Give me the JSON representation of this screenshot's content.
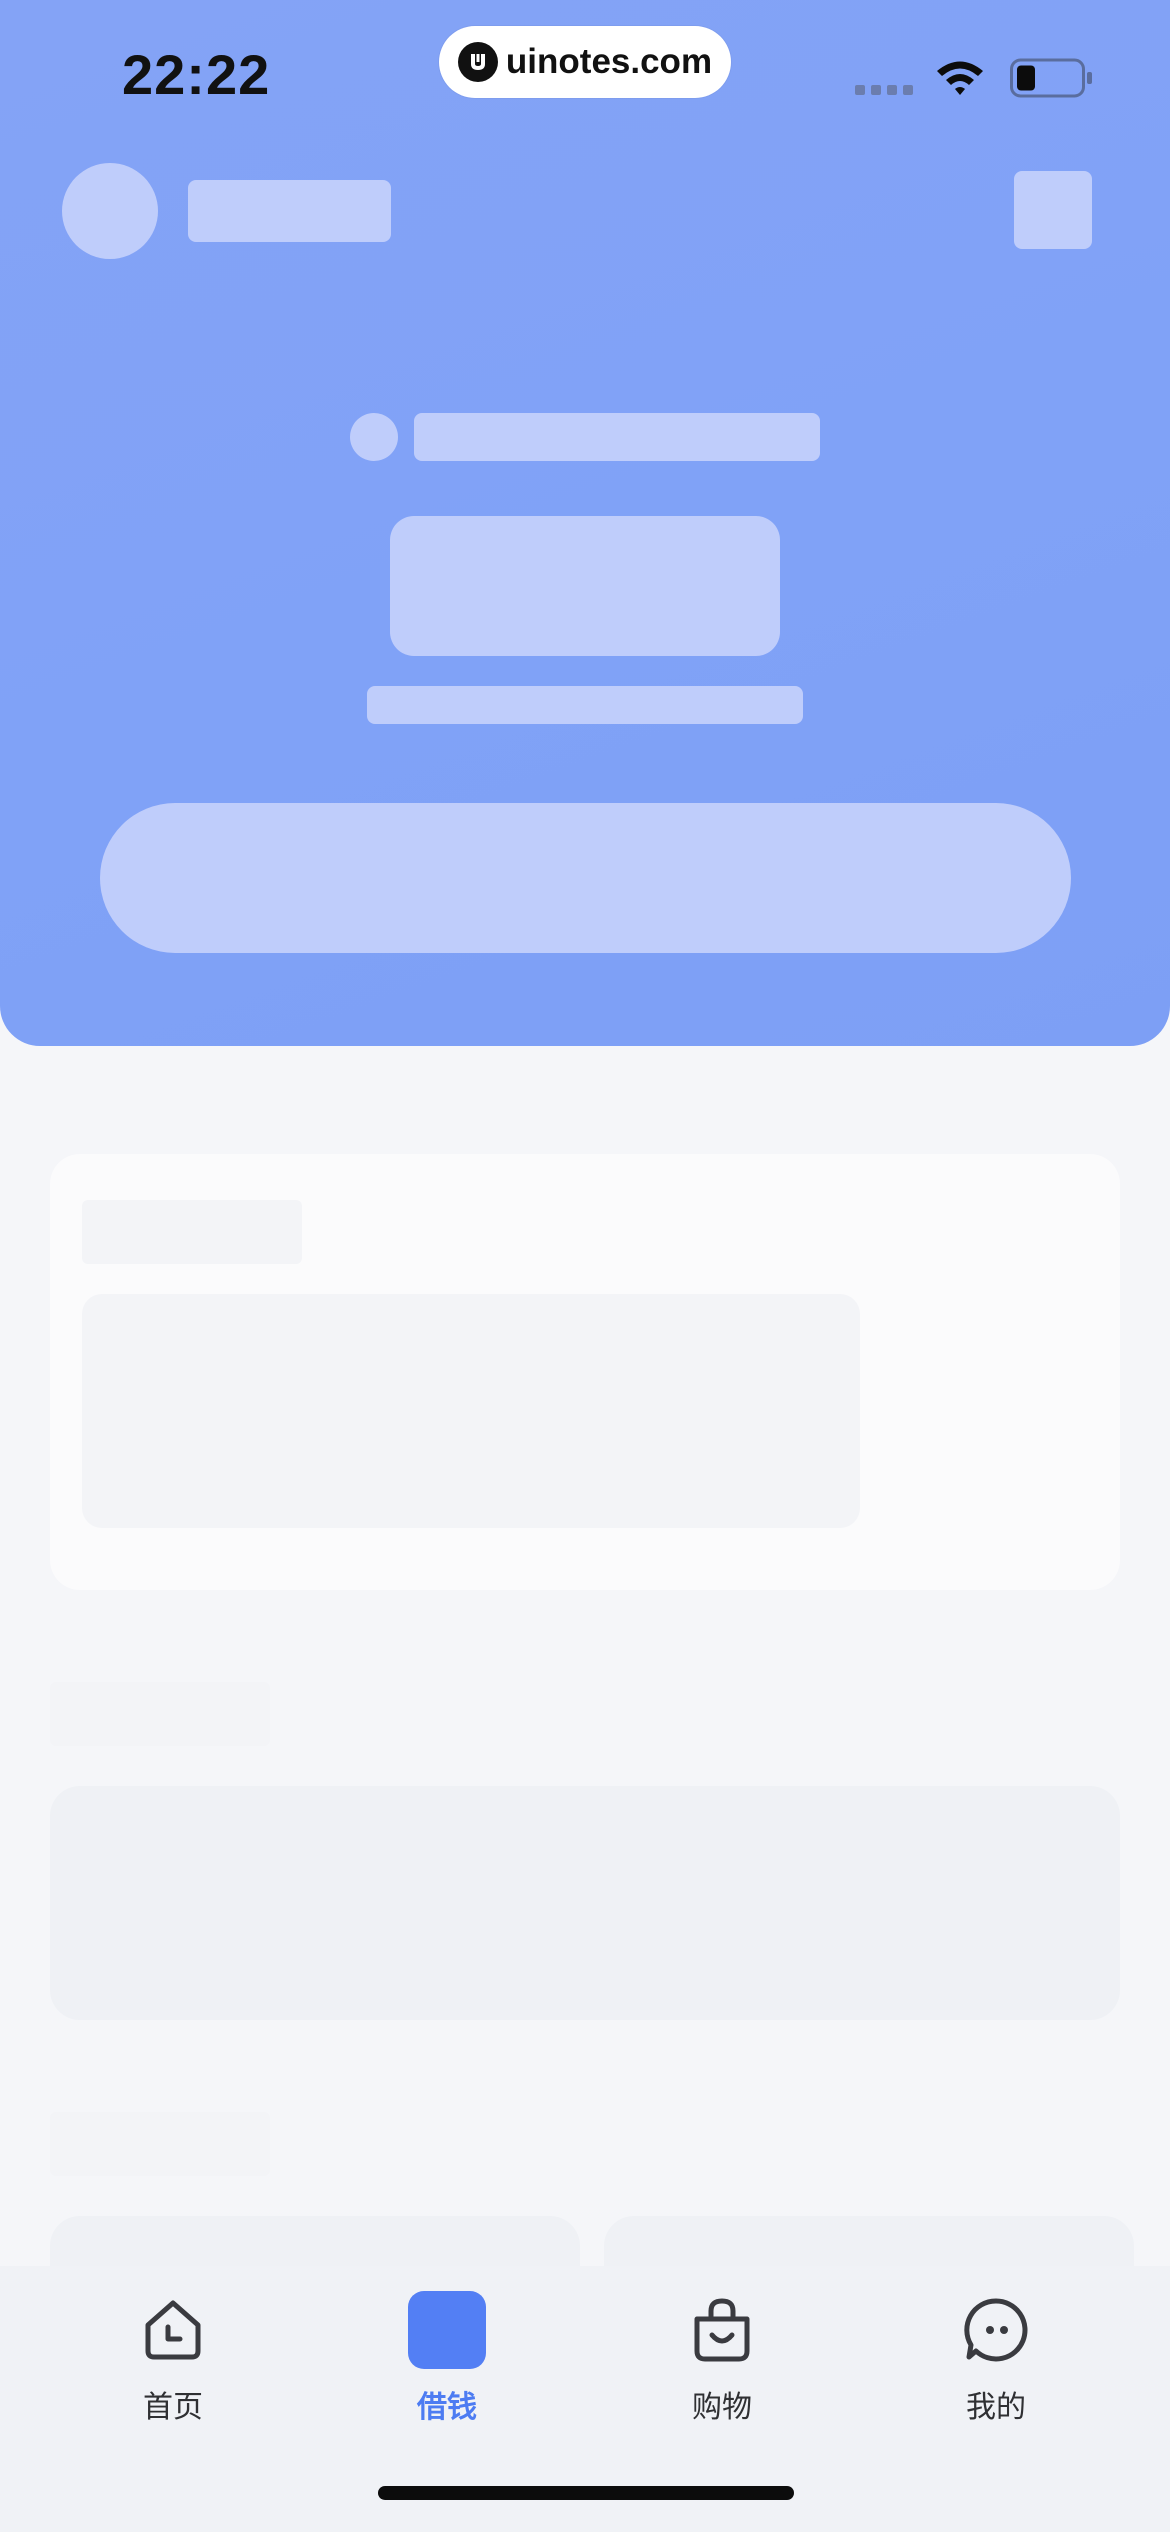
{
  "status_bar": {
    "time": "22:22",
    "watermark": "uinotes.com"
  },
  "tabbar": {
    "tabs": [
      {
        "label": "首页",
        "icon": "home-icon",
        "active": false
      },
      {
        "label": "借钱",
        "icon": "borrow-icon",
        "active": true
      },
      {
        "label": "购物",
        "icon": "shopping-bag-icon",
        "active": false
      },
      {
        "label": "我的",
        "icon": "chat-profile-icon",
        "active": false
      }
    ]
  },
  "colors": {
    "hero_blue": "#80a2f7",
    "placeholder": "#bfcdfb",
    "active_tab": "#4d7cf2",
    "inactive_tab": "#2f3033",
    "page_bg": "#f5f6f9"
  }
}
